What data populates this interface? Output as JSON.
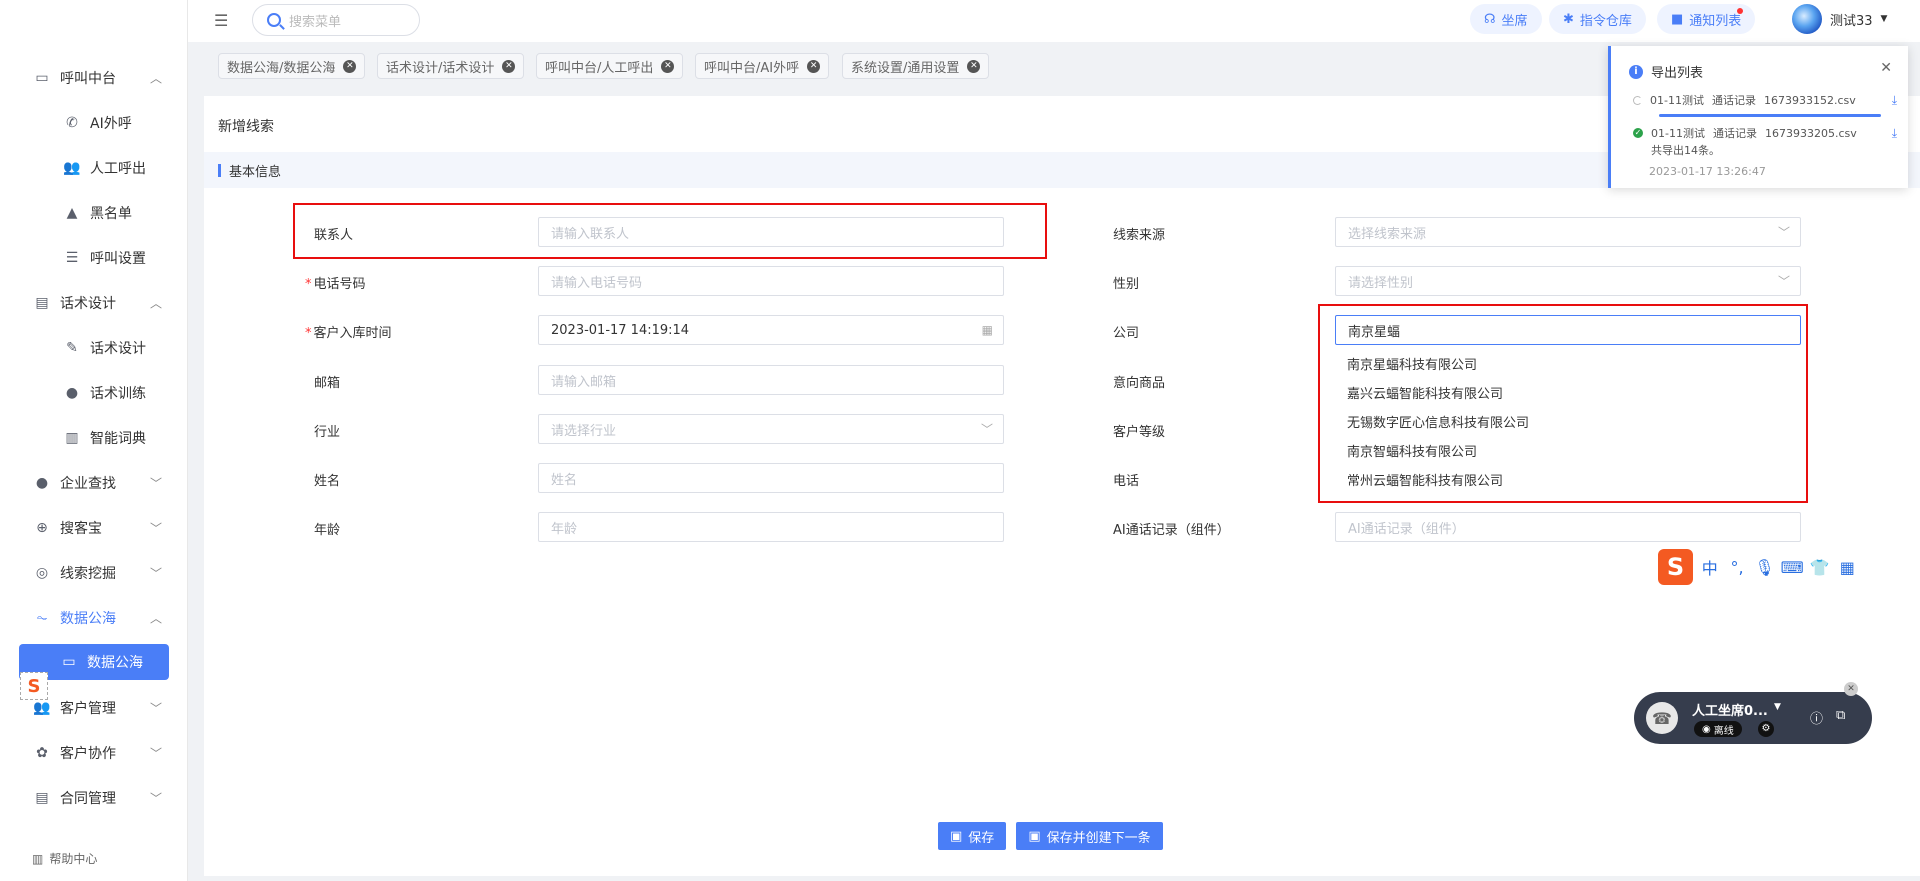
{
  "sidebar": {
    "items": [
      {
        "label": "呼叫中台",
        "icon": "monitor-icon",
        "chevron": "︿"
      },
      {
        "label": "AI外呼",
        "icon": "phone-icon",
        "sub": true
      },
      {
        "label": "人工呼出",
        "icon": "person-icon",
        "sub": true
      },
      {
        "label": "黑名单",
        "icon": "warning-icon",
        "sub": true
      },
      {
        "label": "呼叫设置",
        "icon": "sliders-icon",
        "sub": true
      },
      {
        "label": "话术设计",
        "icon": "document-icon",
        "chevron": "︿"
      },
      {
        "label": "话术设计",
        "icon": "pen-icon",
        "sub": true
      },
      {
        "label": "话术训练",
        "icon": "chat-icon",
        "sub": true
      },
      {
        "label": "智能词典",
        "icon": "book-icon",
        "sub": true
      },
      {
        "label": "企业查找",
        "icon": "bulb-icon",
        "chevron": "﹀"
      },
      {
        "label": "搜客宝",
        "icon": "search-plus-icon",
        "chevron": "﹀"
      },
      {
        "label": "线索挖掘",
        "icon": "target-icon",
        "chevron": "﹀"
      },
      {
        "label": "数据公海",
        "icon": "chart-icon",
        "chevron": "︿",
        "highlight": true
      },
      {
        "label": "数据公海",
        "icon": "laptop-icon",
        "sub": true,
        "active": true
      },
      {
        "label": "客户管理",
        "icon": "users-icon",
        "chevron": "﹀"
      },
      {
        "label": "客户协作",
        "icon": "share-icon",
        "chevron": "﹀"
      },
      {
        "label": "合同管理",
        "icon": "clipboard-icon",
        "chevron": "﹀"
      }
    ],
    "help": "帮助中心"
  },
  "topbar": {
    "search_placeholder": "搜索菜单",
    "buttons": [
      {
        "label": "坐席",
        "icon": "headset-icon"
      },
      {
        "label": "指令仓库",
        "icon": "bolt-icon"
      },
      {
        "label": "通知列表",
        "icon": "bell-icon"
      }
    ],
    "user": "测试33"
  },
  "tabs": [
    "数据公海/数据公海",
    "话术设计/话术设计",
    "呼叫中台/人工呼出",
    "呼叫中台/AI外呼",
    "系统设置/通用设置"
  ],
  "form": {
    "title": "新增线索",
    "section": "基本信息",
    "left": [
      {
        "label": "联系人",
        "placeholder": "请输入联系人"
      },
      {
        "label": "电话号码",
        "placeholder": "请输入电话号码",
        "required": true
      },
      {
        "label": "客户入库时间",
        "value": "2023-01-17 14:19:14",
        "required": true
      },
      {
        "label": "邮箱",
        "placeholder": "请输入邮箱"
      },
      {
        "label": "行业",
        "placeholder": "请选择行业"
      },
      {
        "label": "姓名",
        "placeholder": "姓名"
      },
      {
        "label": "年龄",
        "placeholder": "年龄"
      }
    ],
    "right": [
      {
        "label": "线索来源",
        "placeholder": "选择线索来源"
      },
      {
        "label": "性别",
        "placeholder": "请选择性别"
      },
      {
        "label": "公司",
        "value": "南京星蝠"
      },
      {
        "label": "意向商品"
      },
      {
        "label": "客户等级"
      },
      {
        "label": "电话"
      },
      {
        "label": "AI通话记录（组件）",
        "placeholder": "AI通话记录（组件）"
      }
    ],
    "company_suggestions": [
      "南京星蝠科技有限公司",
      "嘉兴云蝠智能科技有限公司",
      "无锡数字匠心信息科技有限公司",
      "南京智蝠科技有限公司",
      "常州云蝠智能科技有限公司"
    ],
    "save": "保存",
    "save_next": "保存并创建下一条"
  },
  "export_panel": {
    "title": "导出列表",
    "rows": [
      {
        "name": "01-11测试",
        "type": "通话记录",
        "file": "1673933152.csv"
      },
      {
        "name": "01-11测试",
        "type": "通话记录",
        "file": "1673933205.csv"
      }
    ],
    "summary": "共导出14条。",
    "time": "2023-01-17 13:26:47"
  },
  "phone_widget": {
    "name": "人工坐席0...",
    "status": "离线"
  },
  "ime": {
    "logo": "S",
    "lang": "中"
  },
  "colors": {
    "accent": "#4a7ef7",
    "highlight_box": "#e80e0e"
  }
}
